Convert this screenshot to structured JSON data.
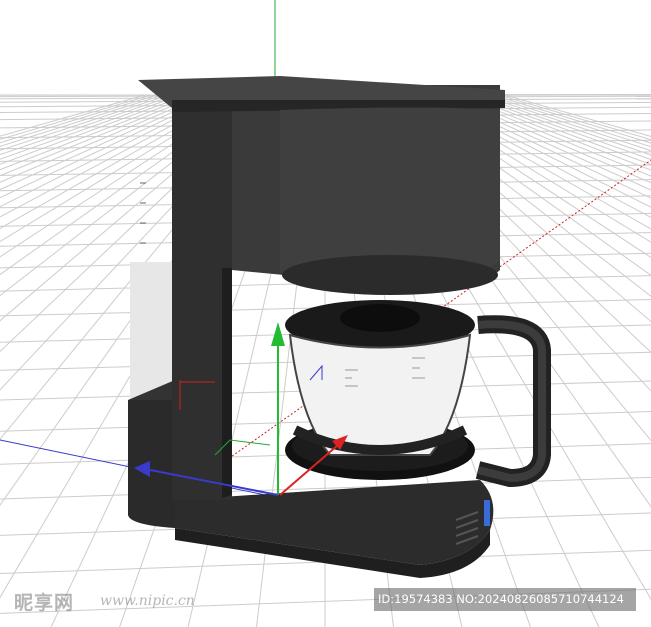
{
  "viewport": {
    "name": "3D perspective viewport",
    "colors": {
      "background": "#ffffff",
      "grid": "#c8c8c8",
      "axis_x": "#cc2222",
      "axis_y": "#22aa33",
      "axis_z": "#3a3acc",
      "model_body": "#2e2e2e"
    }
  },
  "object": {
    "description_icon": "coffee-maker-model"
  },
  "gizmo": {
    "x_color": "#dd2222",
    "y_color": "#22bb33",
    "z_color": "#3a3acc"
  },
  "watermark": {
    "logo": "昵享网",
    "url": "www.nipic.cn",
    "id_text": "ID:19574383 NO:20240826085710744124"
  }
}
